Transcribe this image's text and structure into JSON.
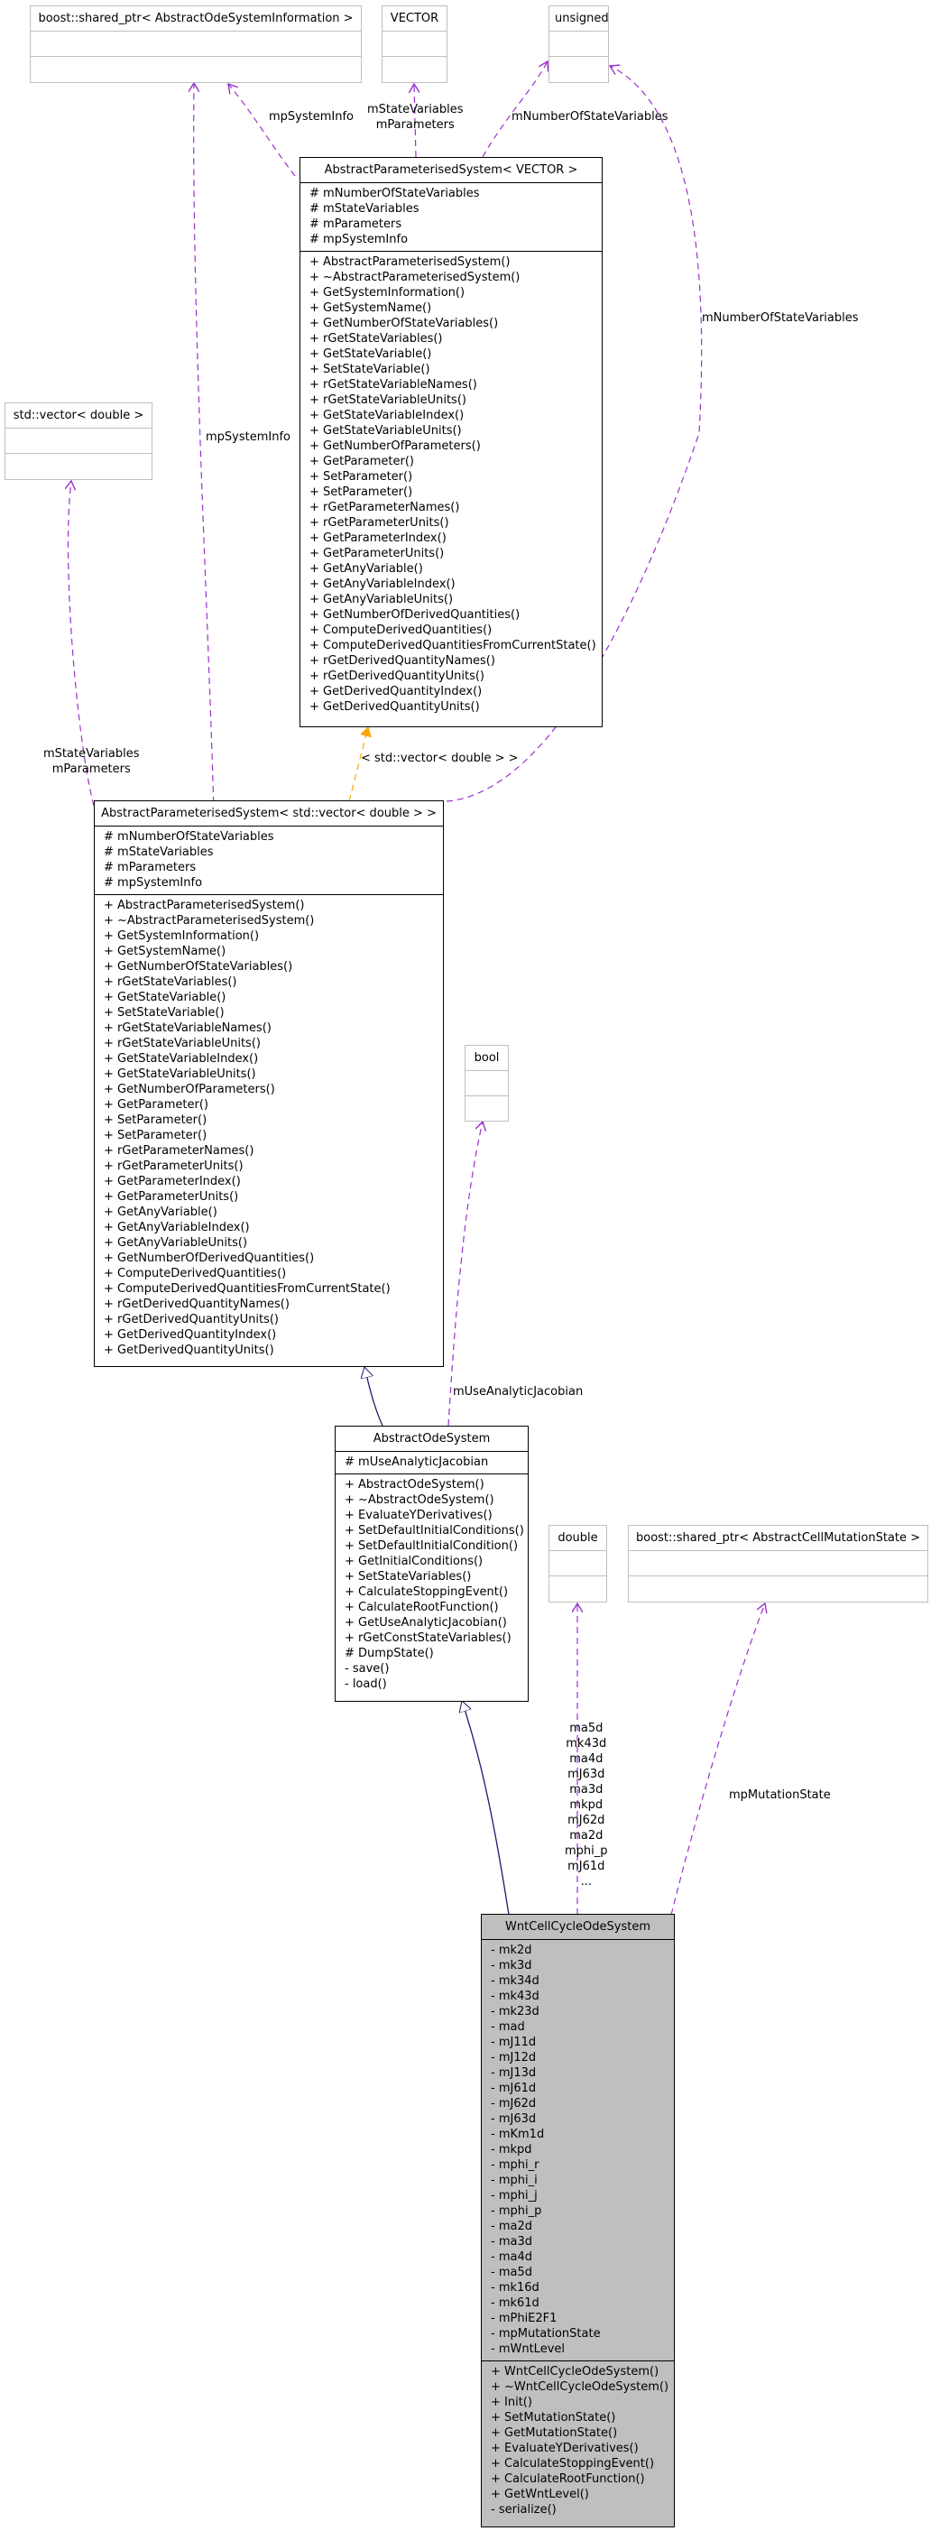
{
  "colors": {
    "association": "#9a32cd",
    "template": "#ffa500",
    "inheritance": "#191970",
    "focus_fill": "#bfbfbf",
    "external_border": "#bfbfbf"
  },
  "classes": {
    "shared_ptr_info": {
      "name": "boost::shared_ptr< AbstractOdeSystemInformation >"
    },
    "vector_t": {
      "name": "VECTOR"
    },
    "unsigned_t": {
      "name": "unsigned"
    },
    "std_vector": {
      "name": "std::vector< double >"
    },
    "bool_t": {
      "name": "bool"
    },
    "double_t": {
      "name": "double"
    },
    "shared_ptr_mutation": {
      "name": "boost::shared_ptr< AbstractCellMutationState >"
    },
    "aps_vector": {
      "name": "AbstractParameterisedSystem< VECTOR >",
      "attributes": [
        "# mNumberOfStateVariables",
        "# mStateVariables",
        "# mParameters",
        "# mpSystemInfo"
      ],
      "methods": [
        "+ AbstractParameterisedSystem()",
        "+ ~AbstractParameterisedSystem()",
        "+ GetSystemInformation()",
        "+ GetSystemName()",
        "+ GetNumberOfStateVariables()",
        "+ rGetStateVariables()",
        "+ GetStateVariable()",
        "+ SetStateVariable()",
        "+ rGetStateVariableNames()",
        "+ rGetStateVariableUnits()",
        "+ GetStateVariableIndex()",
        "+ GetStateVariableUnits()",
        "+ GetNumberOfParameters()",
        "+ GetParameter()",
        "+ SetParameter()",
        "+ SetParameter()",
        "+ rGetParameterNames()",
        "+ rGetParameterUnits()",
        "+ GetParameterIndex()",
        "+ GetParameterUnits()",
        "+ GetAnyVariable()",
        "+ GetAnyVariableIndex()",
        "+ GetAnyVariableUnits()",
        "+ GetNumberOfDerivedQuantities()",
        "+ ComputeDerivedQuantities()",
        "+ ComputeDerivedQuantitiesFromCurrentState()",
        "+ rGetDerivedQuantityNames()",
        "+ rGetDerivedQuantityUnits()",
        "+ GetDerivedQuantityIndex()",
        "+ GetDerivedQuantityUnits()"
      ]
    },
    "aps_stdvector": {
      "name": "AbstractParameterisedSystem< std::vector< double > >",
      "attributes": [
        "# mNumberOfStateVariables",
        "# mStateVariables",
        "# mParameters",
        "# mpSystemInfo"
      ],
      "methods": [
        "+ AbstractParameterisedSystem()",
        "+ ~AbstractParameterisedSystem()",
        "+ GetSystemInformation()",
        "+ GetSystemName()",
        "+ GetNumberOfStateVariables()",
        "+ rGetStateVariables()",
        "+ GetStateVariable()",
        "+ SetStateVariable()",
        "+ rGetStateVariableNames()",
        "+ rGetStateVariableUnits()",
        "+ GetStateVariableIndex()",
        "+ GetStateVariableUnits()",
        "+ GetNumberOfParameters()",
        "+ GetParameter()",
        "+ SetParameter()",
        "+ SetParameter()",
        "+ rGetParameterNames()",
        "+ rGetParameterUnits()",
        "+ GetParameterIndex()",
        "+ GetParameterUnits()",
        "+ GetAnyVariable()",
        "+ GetAnyVariableIndex()",
        "+ GetAnyVariableUnits()",
        "+ GetNumberOfDerivedQuantities()",
        "+ ComputeDerivedQuantities()",
        "+ ComputeDerivedQuantitiesFromCurrentState()",
        "+ rGetDerivedQuantityNames()",
        "+ rGetDerivedQuantityUnits()",
        "+ GetDerivedQuantityIndex()",
        "+ GetDerivedQuantityUnits()"
      ]
    },
    "abstract_ode": {
      "name": "AbstractOdeSystem",
      "attributes": [
        "# mUseAnalyticJacobian"
      ],
      "methods": [
        "+ AbstractOdeSystem()",
        "+ ~AbstractOdeSystem()",
        "+ EvaluateYDerivatives()",
        "+ SetDefaultInitialConditions()",
        "+ SetDefaultInitialCondition()",
        "+ GetInitialConditions()",
        "+ SetStateVariables()",
        "+ CalculateStoppingEvent()",
        "+ CalculateRootFunction()",
        "+ GetUseAnalyticJacobian()",
        "+ rGetConstStateVariables()",
        "# DumpState()",
        "- save()",
        "- load()"
      ]
    },
    "wnt": {
      "name": "WntCellCycleOdeSystem",
      "attributes": [
        "- mk2d",
        "- mk3d",
        "- mk34d",
        "- mk43d",
        "- mk23d",
        "- mad",
        "- mJ11d",
        "- mJ12d",
        "- mJ13d",
        "- mJ61d",
        "- mJ62d",
        "- mJ63d",
        "- mKm1d",
        "- mkpd",
        "- mphi_r",
        "- mphi_i",
        "- mphi_j",
        "- mphi_p",
        "- ma2d",
        "- ma3d",
        "- ma4d",
        "- ma5d",
        "- mk16d",
        "- mk61d",
        "- mPhiE2F1",
        "- mpMutationState",
        "- mWntLevel"
      ],
      "methods": [
        "+ WntCellCycleOdeSystem()",
        "+ ~WntCellCycleOdeSystem()",
        "+ Init()",
        "+ SetMutationState()",
        "+ GetMutationState()",
        "+ EvaluateYDerivatives()",
        "+ CalculateStoppingEvent()",
        "+ CalculateRootFunction()",
        "+ GetWntLevel()",
        "- serialize()"
      ]
    }
  },
  "edge_labels": {
    "mpSystemInfo_1": "mpSystemInfo",
    "mpSystemInfo_2": "mpSystemInfo",
    "vector_members": "mStateVariables\nmParameters",
    "unsigned_1": "mNumberOfStateVariables",
    "unsigned_2": "mNumberOfStateVariables",
    "stdvector_members": "mStateVariables\nmParameters",
    "template_arg": "< std::vector< double > >",
    "bool_member": "mUseAnalyticJacobian",
    "double_members": "ma5d\nmk43d\nma4d\nmJ63d\nma3d\nmkpd\nmJ62d\nma2d\nmphi_p\nmJ61d\n...",
    "mutation_member": "mpMutationState"
  }
}
